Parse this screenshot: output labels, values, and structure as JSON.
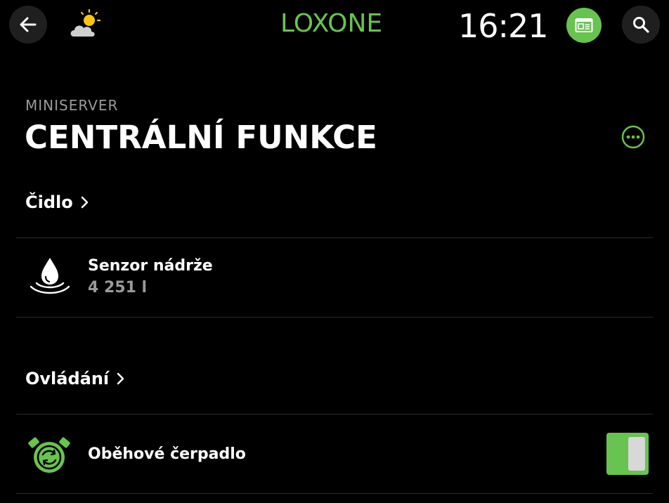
{
  "header": {
    "logo": "LOXONE",
    "time": "16:21",
    "back_icon": "arrow-left-icon",
    "weather_icon": "partly-cloudy-icon",
    "news_icon": "news-icon",
    "search_icon": "search-icon"
  },
  "page": {
    "subtitle": "MINISERVER",
    "title": "CENTRÁLNÍ FUNKCE"
  },
  "sections": [
    {
      "label": "Čidlo",
      "items": [
        {
          "name": "Senzor nádrže",
          "value": "4 251 l",
          "icon": "water-drop-icon"
        }
      ]
    },
    {
      "label": "Ovládání",
      "items": [
        {
          "name": "Oběhové čerpadlo",
          "icon": "circulation-pump-icon",
          "state": "on"
        }
      ]
    }
  ],
  "colors": {
    "accent": "#69c350",
    "background": "#000000",
    "muted_text": "#9a9a9a",
    "divider": "#2b2b2b"
  }
}
